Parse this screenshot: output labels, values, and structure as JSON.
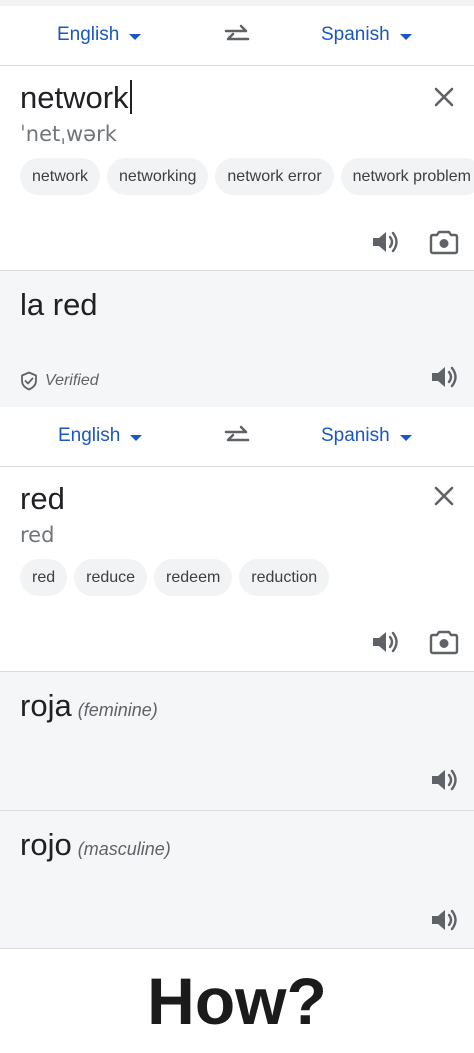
{
  "panel1": {
    "source_lang": "English",
    "target_lang": "Spanish",
    "input_text": "network",
    "transliteration": "ˈnetˌwərk",
    "suggestions": [
      "network",
      "networking",
      "network error",
      "network problem"
    ],
    "translation": "la red",
    "verified_label": "Verified"
  },
  "panel2": {
    "source_lang": "English",
    "target_lang": "Spanish",
    "input_text": "red",
    "transliteration": "red",
    "suggestions": [
      "red",
      "reduce",
      "redeem",
      "reduction"
    ],
    "translations": [
      {
        "text": "roja",
        "gender": "(feminine)"
      },
      {
        "text": "rojo",
        "gender": "(masculine)"
      }
    ]
  },
  "caption": "How?",
  "colors": {
    "accent": "#1a57c4",
    "output_bg": "#f5f6f7",
    "chip_bg": "#f1f3f4",
    "divider": "#dadce0"
  }
}
